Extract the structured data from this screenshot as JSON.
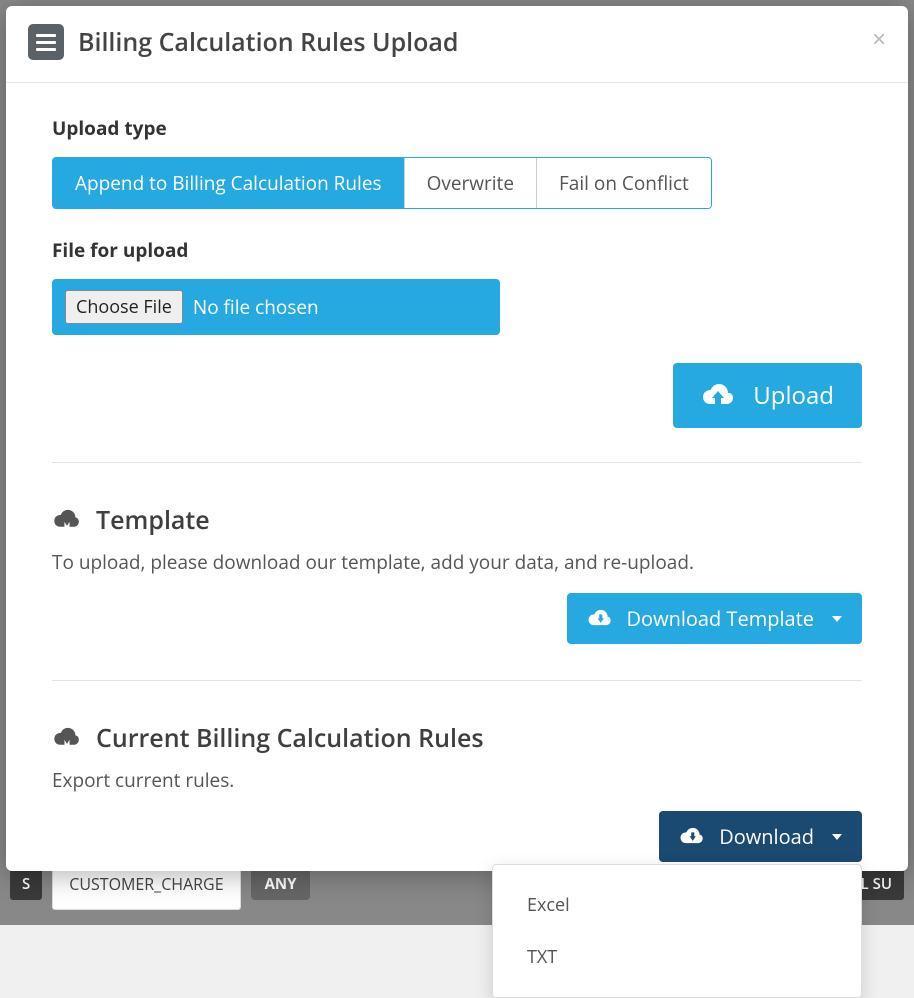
{
  "modal": {
    "title": "Billing Calculation Rules Upload",
    "close_label": "×"
  },
  "upload_type": {
    "label": "Upload type",
    "options": [
      {
        "label": "Append to Billing Calculation Rules",
        "active": true
      },
      {
        "label": "Overwrite",
        "active": false
      },
      {
        "label": "Fail on Conflict",
        "active": false
      }
    ]
  },
  "file_upload": {
    "label": "File for upload",
    "choose_label": "Choose File",
    "status": "No file chosen"
  },
  "upload_button": "Upload",
  "template_section": {
    "title": "Template",
    "desc": "To upload, please download our template, add your data, and re-upload.",
    "download_label": "Download Template"
  },
  "current_section": {
    "title": "Current Billing Calculation Rules",
    "desc": "Export current rules.",
    "download_label": "Download",
    "options": [
      "Excel",
      "TXT"
    ]
  },
  "background": {
    "cell1": "CUSTOMER_CHARGE",
    "cell2": "ANY",
    "cell3": "UEL SU"
  }
}
